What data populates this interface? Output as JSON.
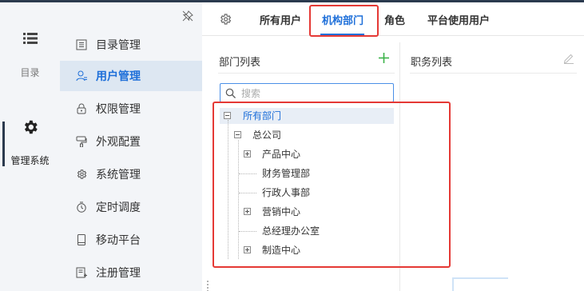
{
  "rail": {
    "menu_label": "目录",
    "system_label": "管理系统"
  },
  "sidebar": {
    "items": [
      {
        "label": "目录管理",
        "icon": "document-icon",
        "active": false
      },
      {
        "label": "用户管理",
        "icon": "user-icon",
        "active": true
      },
      {
        "label": "权限管理",
        "icon": "lock-icon",
        "active": false
      },
      {
        "label": "外观配置",
        "icon": "brush-icon",
        "active": false
      },
      {
        "label": "系统管理",
        "icon": "gear-icon",
        "active": false
      },
      {
        "label": "定时调度",
        "icon": "timer-icon",
        "active": false
      },
      {
        "label": "移动平台",
        "icon": "mobile-icon",
        "active": false
      },
      {
        "label": "注册管理",
        "icon": "register-icon",
        "active": false
      }
    ]
  },
  "tabs": [
    {
      "label": "所有用户",
      "active": false
    },
    {
      "label": "机构部门",
      "active": true
    },
    {
      "label": "角色",
      "active": false
    },
    {
      "label": "平台使用用户",
      "active": false
    }
  ],
  "dept_panel": {
    "title": "部门列表",
    "search_placeholder": "搜索"
  },
  "position_panel": {
    "title": "职务列表"
  },
  "tree": {
    "root": "所有部门",
    "company": "总公司",
    "children": [
      {
        "label": "产品中心",
        "expandable": true
      },
      {
        "label": "财务管理部",
        "expandable": false
      },
      {
        "label": "行政人事部",
        "expandable": false
      },
      {
        "label": "营销中心",
        "expandable": true
      },
      {
        "label": "总经理办公室",
        "expandable": false
      },
      {
        "label": "制造中心",
        "expandable": true
      }
    ]
  },
  "colors": {
    "accent": "#1e6fd9",
    "highlight_box": "#e53935",
    "sidebar_bg": "#f3f5f8",
    "add_icon": "#3cb34a"
  }
}
